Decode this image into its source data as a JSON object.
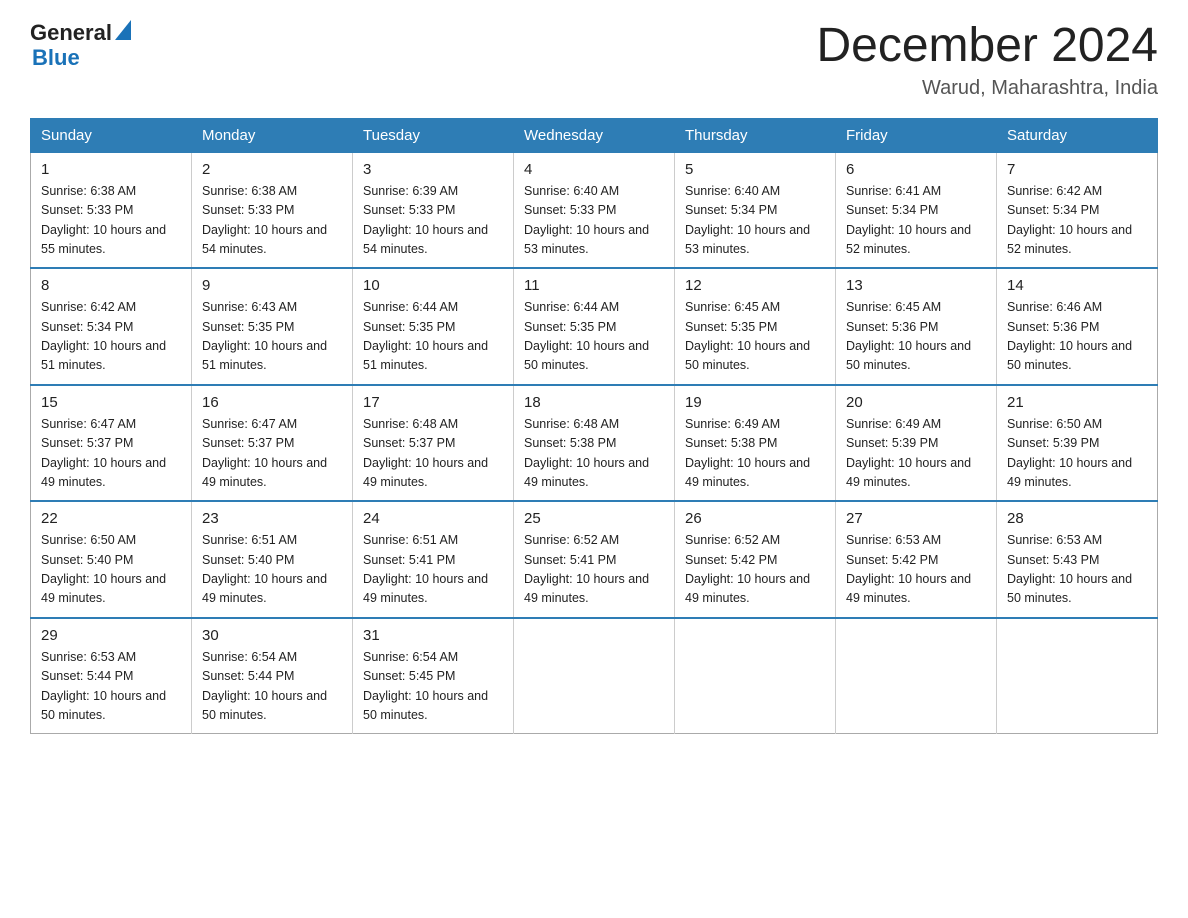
{
  "header": {
    "logo_general": "General",
    "logo_blue": "Blue",
    "title": "December 2024",
    "subtitle": "Warud, Maharashtra, India"
  },
  "weekdays": [
    "Sunday",
    "Monday",
    "Tuesday",
    "Wednesday",
    "Thursday",
    "Friday",
    "Saturday"
  ],
  "weeks": [
    [
      {
        "day": 1,
        "sunrise": "6:38 AM",
        "sunset": "5:33 PM",
        "daylight": "10 hours and 55 minutes."
      },
      {
        "day": 2,
        "sunrise": "6:38 AM",
        "sunset": "5:33 PM",
        "daylight": "10 hours and 54 minutes."
      },
      {
        "day": 3,
        "sunrise": "6:39 AM",
        "sunset": "5:33 PM",
        "daylight": "10 hours and 54 minutes."
      },
      {
        "day": 4,
        "sunrise": "6:40 AM",
        "sunset": "5:33 PM",
        "daylight": "10 hours and 53 minutes."
      },
      {
        "day": 5,
        "sunrise": "6:40 AM",
        "sunset": "5:34 PM",
        "daylight": "10 hours and 53 minutes."
      },
      {
        "day": 6,
        "sunrise": "6:41 AM",
        "sunset": "5:34 PM",
        "daylight": "10 hours and 52 minutes."
      },
      {
        "day": 7,
        "sunrise": "6:42 AM",
        "sunset": "5:34 PM",
        "daylight": "10 hours and 52 minutes."
      }
    ],
    [
      {
        "day": 8,
        "sunrise": "6:42 AM",
        "sunset": "5:34 PM",
        "daylight": "10 hours and 51 minutes."
      },
      {
        "day": 9,
        "sunrise": "6:43 AM",
        "sunset": "5:35 PM",
        "daylight": "10 hours and 51 minutes."
      },
      {
        "day": 10,
        "sunrise": "6:44 AM",
        "sunset": "5:35 PM",
        "daylight": "10 hours and 51 minutes."
      },
      {
        "day": 11,
        "sunrise": "6:44 AM",
        "sunset": "5:35 PM",
        "daylight": "10 hours and 50 minutes."
      },
      {
        "day": 12,
        "sunrise": "6:45 AM",
        "sunset": "5:35 PM",
        "daylight": "10 hours and 50 minutes."
      },
      {
        "day": 13,
        "sunrise": "6:45 AM",
        "sunset": "5:36 PM",
        "daylight": "10 hours and 50 minutes."
      },
      {
        "day": 14,
        "sunrise": "6:46 AM",
        "sunset": "5:36 PM",
        "daylight": "10 hours and 50 minutes."
      }
    ],
    [
      {
        "day": 15,
        "sunrise": "6:47 AM",
        "sunset": "5:37 PM",
        "daylight": "10 hours and 49 minutes."
      },
      {
        "day": 16,
        "sunrise": "6:47 AM",
        "sunset": "5:37 PM",
        "daylight": "10 hours and 49 minutes."
      },
      {
        "day": 17,
        "sunrise": "6:48 AM",
        "sunset": "5:37 PM",
        "daylight": "10 hours and 49 minutes."
      },
      {
        "day": 18,
        "sunrise": "6:48 AM",
        "sunset": "5:38 PM",
        "daylight": "10 hours and 49 minutes."
      },
      {
        "day": 19,
        "sunrise": "6:49 AM",
        "sunset": "5:38 PM",
        "daylight": "10 hours and 49 minutes."
      },
      {
        "day": 20,
        "sunrise": "6:49 AM",
        "sunset": "5:39 PM",
        "daylight": "10 hours and 49 minutes."
      },
      {
        "day": 21,
        "sunrise": "6:50 AM",
        "sunset": "5:39 PM",
        "daylight": "10 hours and 49 minutes."
      }
    ],
    [
      {
        "day": 22,
        "sunrise": "6:50 AM",
        "sunset": "5:40 PM",
        "daylight": "10 hours and 49 minutes."
      },
      {
        "day": 23,
        "sunrise": "6:51 AM",
        "sunset": "5:40 PM",
        "daylight": "10 hours and 49 minutes."
      },
      {
        "day": 24,
        "sunrise": "6:51 AM",
        "sunset": "5:41 PM",
        "daylight": "10 hours and 49 minutes."
      },
      {
        "day": 25,
        "sunrise": "6:52 AM",
        "sunset": "5:41 PM",
        "daylight": "10 hours and 49 minutes."
      },
      {
        "day": 26,
        "sunrise": "6:52 AM",
        "sunset": "5:42 PM",
        "daylight": "10 hours and 49 minutes."
      },
      {
        "day": 27,
        "sunrise": "6:53 AM",
        "sunset": "5:42 PM",
        "daylight": "10 hours and 49 minutes."
      },
      {
        "day": 28,
        "sunrise": "6:53 AM",
        "sunset": "5:43 PM",
        "daylight": "10 hours and 50 minutes."
      }
    ],
    [
      {
        "day": 29,
        "sunrise": "6:53 AM",
        "sunset": "5:44 PM",
        "daylight": "10 hours and 50 minutes."
      },
      {
        "day": 30,
        "sunrise": "6:54 AM",
        "sunset": "5:44 PM",
        "daylight": "10 hours and 50 minutes."
      },
      {
        "day": 31,
        "sunrise": "6:54 AM",
        "sunset": "5:45 PM",
        "daylight": "10 hours and 50 minutes."
      },
      null,
      null,
      null,
      null
    ]
  ]
}
